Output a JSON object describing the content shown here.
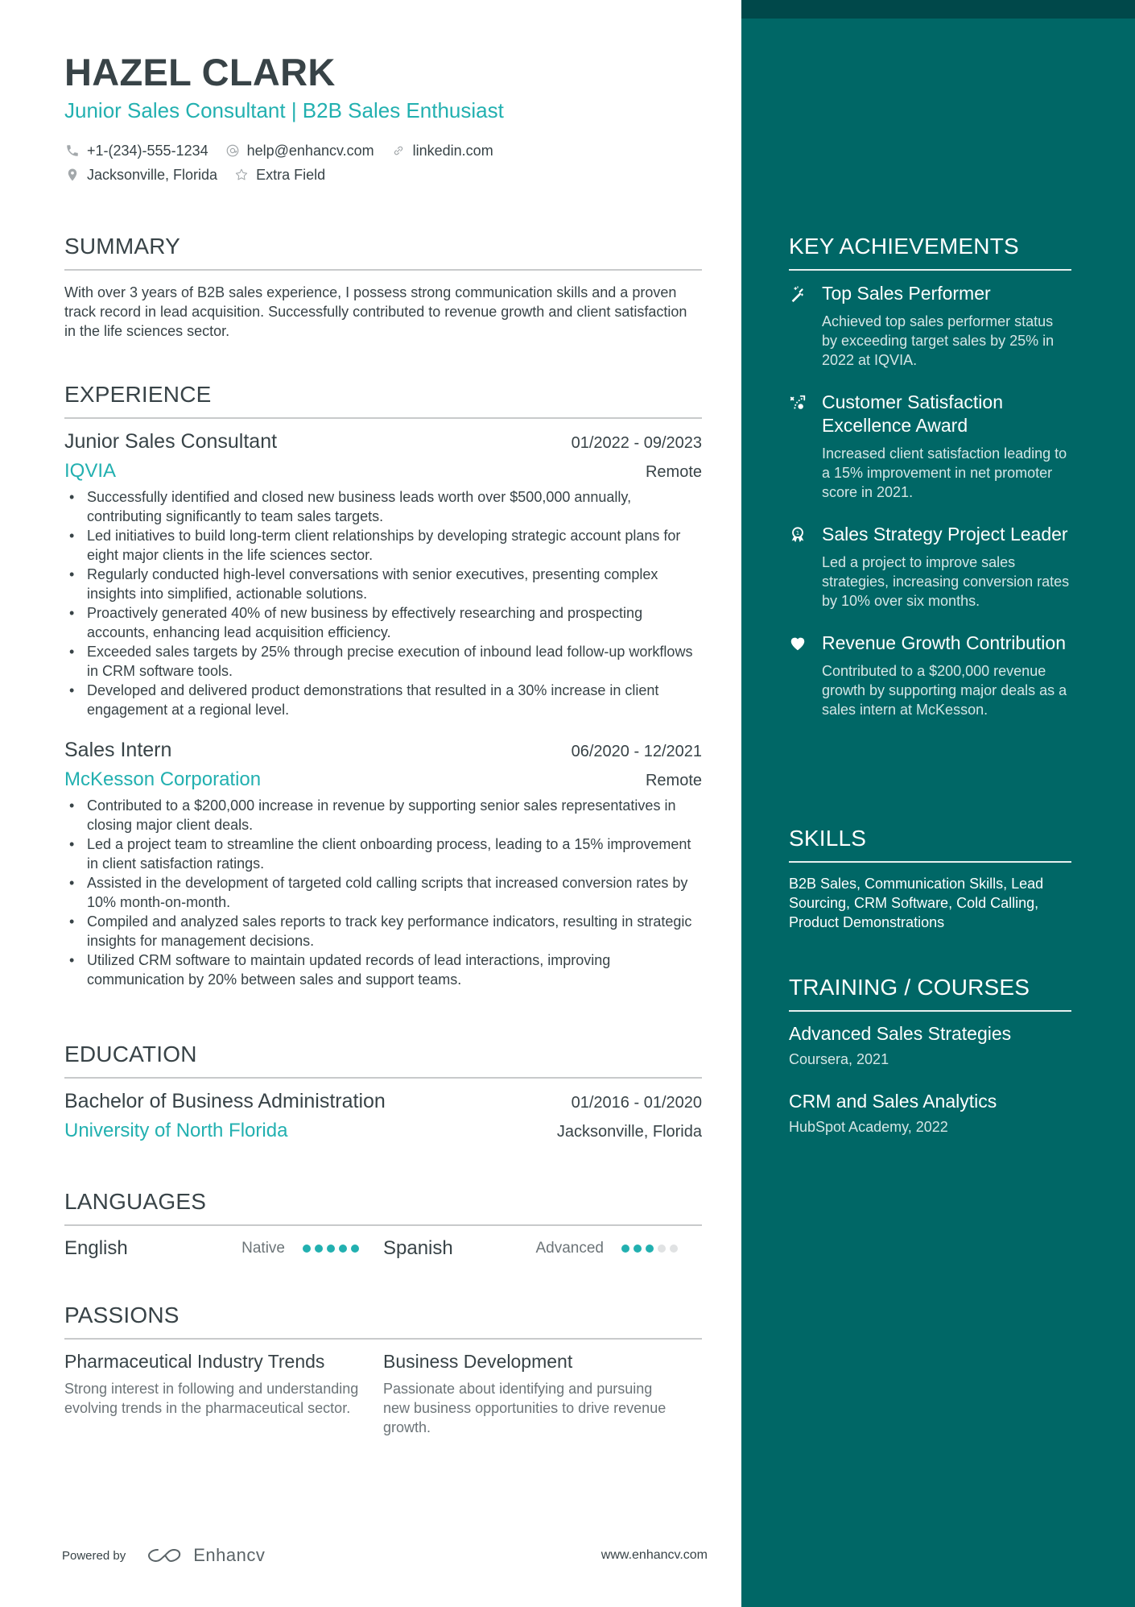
{
  "header": {
    "name": "HAZEL CLARK",
    "headline": "Junior Sales Consultant | B2B Sales Enthusiast",
    "contacts": {
      "phone": {
        "icon": "phone-icon",
        "text": "+1-(234)-555-1234"
      },
      "email": {
        "icon": "at-icon",
        "text": "help@enhancv.com"
      },
      "link": {
        "icon": "link-icon",
        "text": "linkedin.com"
      },
      "location": {
        "icon": "location-pin-icon",
        "text": "Jacksonville, Florida"
      },
      "extra": {
        "icon": "star-icon",
        "text": "Extra Field"
      }
    }
  },
  "colors": {
    "accent": "#22b0b0",
    "text": "#384347",
    "sidebar": "#006766",
    "sidebar_topbar": "#00484a",
    "muted": "#6c7478"
  },
  "summary": {
    "title": "SUMMARY",
    "text": "With over 3 years of B2B sales experience, I possess strong communication skills and a proven track record in lead acquisition. Successfully contributed to revenue growth and client satisfaction in the life sciences sector."
  },
  "experience": {
    "title": "EXPERIENCE",
    "entries": [
      {
        "role": "Junior Sales Consultant",
        "dates": "01/2022 - 09/2023",
        "company": "IQVIA",
        "location": "Remote",
        "bullets": [
          "Successfully identified and closed new business leads worth over $500,000 annually, contributing significantly to team sales targets.",
          "Led initiatives to build long-term client relationships by developing strategic account plans for eight major clients in the life sciences sector.",
          "Regularly conducted high-level conversations with senior executives, presenting complex insights into simplified, actionable solutions.",
          "Proactively generated 40% of new business by effectively researching and prospecting accounts, enhancing lead acquisition efficiency.",
          "Exceeded sales targets by 25% through precise execution of inbound lead follow-up workflows in CRM software tools.",
          "Developed and delivered product demonstrations that resulted in a 30% increase in client engagement at a regional level."
        ]
      },
      {
        "role": "Sales Intern",
        "dates": "06/2020 - 12/2021",
        "company": "McKesson Corporation",
        "location": "Remote",
        "bullets": [
          "Contributed to a $200,000 increase in revenue by supporting senior sales representatives in closing major client deals.",
          "Led a project team to streamline the client onboarding process, leading to a 15% improvement in client satisfaction ratings.",
          "Assisted in the development of targeted cold calling scripts that increased conversion rates by 10% month-on-month.",
          "Compiled and analyzed sales reports to track key performance indicators, resulting in strategic insights for management decisions.",
          "Utilized CRM software to maintain updated records of lead interactions, improving communication by 20% between sales and support teams."
        ]
      }
    ]
  },
  "education": {
    "title": "EDUCATION",
    "entries": [
      {
        "degree": "Bachelor of Business Administration",
        "dates": "01/2016 - 01/2020",
        "school": "University of North Florida",
        "location": "Jacksonville, Florida"
      }
    ]
  },
  "languages": {
    "title": "LANGUAGES",
    "items": [
      {
        "name": "English",
        "level": "Native",
        "rating": 5,
        "max": 5
      },
      {
        "name": "Spanish",
        "level": "Advanced",
        "rating": 3,
        "max": 5
      }
    ]
  },
  "passions": {
    "title": "PASSIONS",
    "items": [
      {
        "title": "Pharmaceutical Industry Trends",
        "desc": "Strong interest in following and understanding evolving trends in the pharmaceutical sector."
      },
      {
        "title": "Business Development",
        "desc": "Passionate about identifying and pursuing new business opportunities to drive revenue growth."
      }
    ]
  },
  "achievements": {
    "title": "KEY ACHIEVEMENTS",
    "items": [
      {
        "icon": "magic-wand-icon",
        "title": "Top Sales Performer",
        "desc": "Achieved top sales performer status by exceeding target sales by 25% in 2022 at IQVIA."
      },
      {
        "icon": "strategy-path-icon",
        "title": "Customer Satisfaction Excellence Award",
        "desc": "Increased client satisfaction leading to a 15% improvement in net promoter score in 2021."
      },
      {
        "icon": "award-medal-icon",
        "title": "Sales Strategy Project Leader",
        "desc": "Led a project to improve sales strategies, increasing conversion rates by 10% over six months."
      },
      {
        "icon": "heart-icon",
        "title": "Revenue Growth Contribution",
        "desc": "Contributed to a $200,000 revenue growth by supporting major deals as a sales intern at McKesson."
      }
    ]
  },
  "skills": {
    "title": "SKILLS",
    "text": "B2B Sales, Communication Skills, Lead Sourcing, CRM Software, Cold Calling, Product Demonstrations"
  },
  "training": {
    "title": "TRAINING / COURSES",
    "items": [
      {
        "title": "Advanced Sales Strategies",
        "sub": "Coursera, 2021"
      },
      {
        "title": "CRM and Sales Analytics",
        "sub": "HubSpot Academy, 2022"
      }
    ]
  },
  "footer": {
    "powered_by": "Powered by",
    "brand": "Enhancv",
    "site": "www.enhancv.com"
  }
}
